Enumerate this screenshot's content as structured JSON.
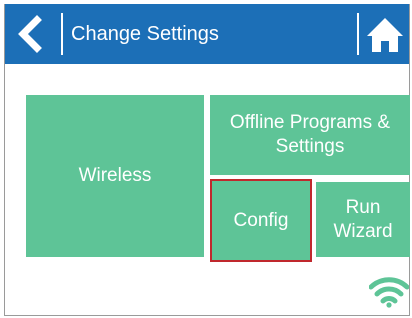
{
  "header": {
    "title": "Change Settings",
    "back_icon": "chevron-left-icon",
    "home_icon": "home-icon",
    "background_color": "#1c6fb7"
  },
  "tiles": {
    "wireless": "Wireless",
    "offline_line1": "Offline Programs &",
    "offline_line2": "Settings",
    "config": "Config",
    "wizard_line1": "Run",
    "wizard_line2": "Wizard",
    "tile_color": "#5ec497",
    "selected": "Config",
    "selected_outline_color": "#c0282d"
  },
  "status": {
    "wifi_icon": "wifi-icon",
    "wifi_color": "#5ec497"
  }
}
